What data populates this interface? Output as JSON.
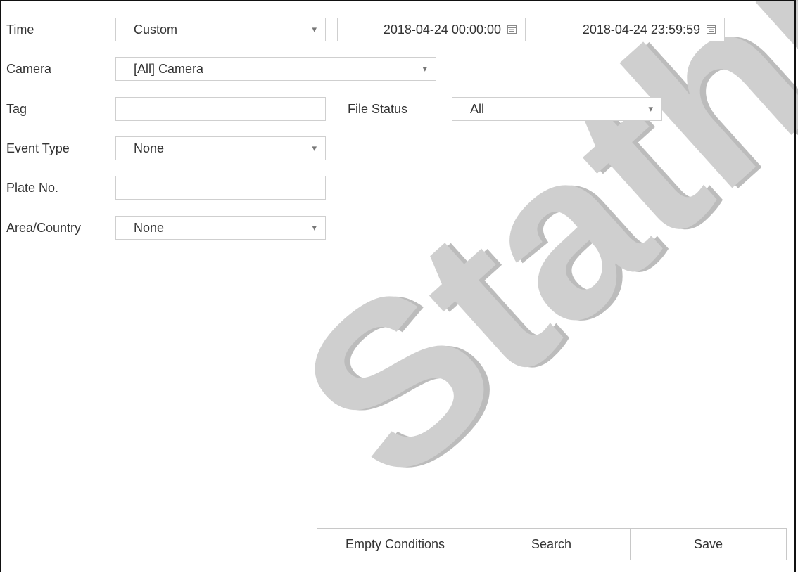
{
  "form": {
    "time": {
      "label": "Time",
      "mode": "Custom",
      "start": "2018-04-24 00:00:00",
      "end": "2018-04-24 23:59:59"
    },
    "camera": {
      "label": "Camera",
      "value": "[All] Camera"
    },
    "tag": {
      "label": "Tag",
      "value": ""
    },
    "file_status": {
      "label": "File Status",
      "value": "All"
    },
    "event_type": {
      "label": "Event Type",
      "value": "None"
    },
    "plate_no": {
      "label": "Plate No.",
      "value": ""
    },
    "area_country": {
      "label": "Area/Country",
      "value": "None"
    }
  },
  "buttons": {
    "empty": "Empty Conditions",
    "search": "Search",
    "save": "Save"
  },
  "watermark": {
    "text": "Stathis Ne",
    "colors": [
      "#c4c4c4",
      "#e8111b"
    ]
  },
  "icons": {
    "dropdown": "chevron-down-icon",
    "calendar": "calendar-icon"
  }
}
